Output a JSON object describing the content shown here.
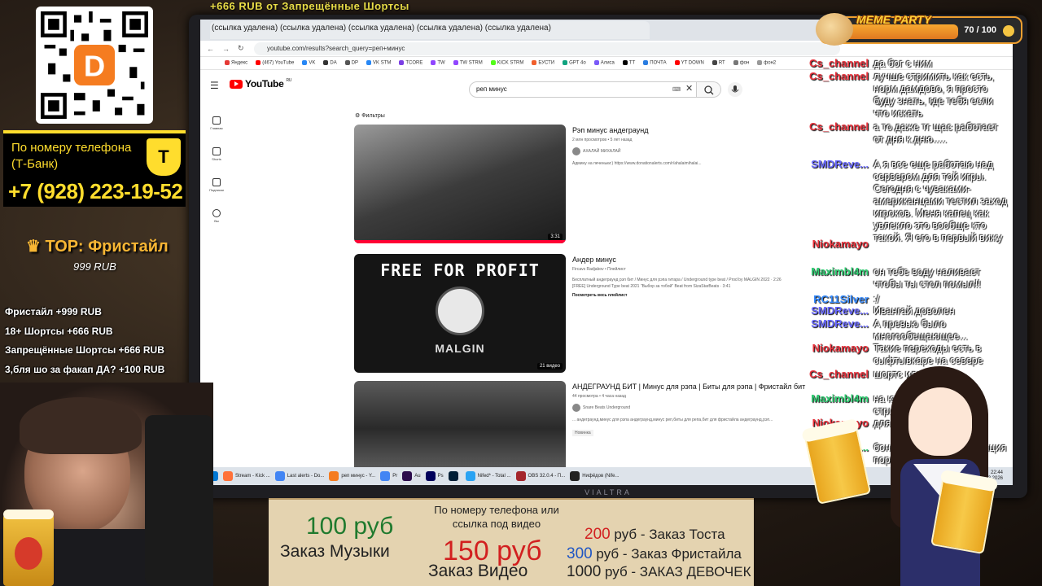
{
  "ticker": {
    "text": "+666 RUB   от Запрещённые Шортсы"
  },
  "browser": {
    "tab_title": "(ссылка удалена) (ссылка удалена) (ссылка удалена) (ссылка удалена) (ссылка удалена)",
    "url": "youtube.com/results?search_query=реп+минус",
    "bookmarks": [
      "Яндекс",
      "(467) YouTube",
      "VK",
      "DA",
      "DP",
      "VK STM",
      "TCORE",
      "TW",
      "TW STRM",
      "KICK STRM",
      "БУСТИ",
      "GPT 4o",
      "Алиса",
      "TT",
      "ПОЧТА",
      "YT DOWN",
      "RT",
      "фон",
      "фон2"
    ]
  },
  "youtube": {
    "logo_text": "YouTube",
    "region": "RU",
    "search_value": "реп минус",
    "filters_label": "Фильтры",
    "sidebar": [
      {
        "label": "Главная",
        "icon": "home-icon"
      },
      {
        "label": "Shorts",
        "icon": "shorts-icon"
      },
      {
        "label": "Подписки",
        "icon": "subscriptions-icon"
      },
      {
        "label": "Вы",
        "icon": "you-icon"
      }
    ],
    "results": [
      {
        "title": "Рэп минус андеграунд",
        "meta": "2 млн просмотров • 5 лет назад",
        "channel": "АХАЛАЙ МИХАЛАЙ",
        "desc": "Админу на печеньки:) https://www.donationalerts.com/r/ahalaimihalai...",
        "duration": "3:31"
      },
      {
        "title": "Андер минус",
        "meta": "Fircavs Radjabov • Плейлист",
        "desc": "Бесплатный андеграунд рэп бит / Минус для рэпа гитара / Underground type beat / Prod by MALGIN 2022 · 2:26",
        "desc2": "[FREE] Underground Type beat 2021 \"Выбор за тобой\" Beat from SizaStarBeats · 3:41",
        "link": "Посмотреть весь плейлист",
        "duration": "21 видео",
        "thumb_text": "FREE FOR PROFIT",
        "thumb_brand": "MALGIN"
      },
      {
        "title": "АНДЕГРАУНД БИТ | Минус для рэпа | Биты для рэпа | Фристайл бит",
        "meta": "44 просмотра • 4 часа назад",
        "channel": "Snare Beats Underground",
        "desc": "... андеграунд,минус для рэпа андеграунд,минус реп,биты для репа,бит для фристайла андеграунд,рэп...",
        "badge": "Новинка"
      }
    ]
  },
  "taskbar": {
    "apps": [
      "Stream - Kick ...",
      "Last alerts - Do...",
      "реп минус - Y...",
      "Pr",
      "Au",
      "Ps",
      "",
      "Nifed* - Total ...",
      "OBS 32.0.4 - П...",
      "Нифёдов (Nife..."
    ],
    "time": "22:44",
    "date": "19.02.2026"
  },
  "monitor_brand": "VIALTRA",
  "donation": {
    "label": "По номеру телефона (Т-Банк)",
    "phone": "+7 (928) 223-19-52",
    "bank_letter": "Т"
  },
  "top": {
    "title": "ТОР: Фристайл",
    "amount": "999 RUB"
  },
  "goals": [
    "Фристайл +999 RUB",
    "18+ Шортсы +666 RUB",
    "Запрещённые Шортсы +666 RUB",
    "3,бля шо за факап ДА? +100 RUB"
  ],
  "meme_party": {
    "title": "MEME PARTY",
    "count": "70 / 100",
    "progress": 0.7
  },
  "chat": [
    {
      "name": "Cs_channel",
      "color": "#e8323c",
      "msg": "да бог с ним"
    },
    {
      "name": "Cs_channel",
      "color": "#e8323c",
      "msg": "лучше стримить как есть, норм дамдово, я просто буду знать, где тебя если что искать"
    },
    {
      "name": "Cs_channel",
      "color": "#e8323c",
      "msg": "а то даже тг щас работает от дня к дню....."
    },
    {
      "name": "SMDReve...",
      "color": "#6a6aff",
      "msg": "А я все еще работаю над сервером для той игры. Сегодня с чуваками-американцами тестил заход игроков. Меня капец как увлекло это вообще кто такой. Я его в первый вижу"
    },
    {
      "name": "Niokamayo",
      "color": "#e8323c",
      "msg": ""
    },
    {
      "name": "Maximbl4m",
      "color": "#2ecc71",
      "msg": "он тебе воду наливает чтобы ты стол помыл!!"
    },
    {
      "name": "RC11Silver",
      "color": "#3a8dff",
      "msg": ":/"
    },
    {
      "name": "SMDReve...",
      "color": "#6a6aff",
      "msg": "Ивангай доволен"
    },
    {
      "name": "SMDReve...",
      "color": "#6a6aff",
      "msg": "А превью было многообещающее..."
    },
    {
      "name": "Niokamayo",
      "color": "#e8323c",
      "msg": "Такие переходы есть в сыфтывкаре на севере"
    },
    {
      "name": "Cs_channel",
      "color": "#e8323c",
      "msg": "шортс или шортс"
    },
    {
      "name": "Maximbl4m",
      "color": "#2ecc71",
      "msg": "на ютубе стрим нельзя стримить"
    },
    {
      "name": "Niokamayo",
      "color": "#e8323c",
      "msg": "для фона"
    },
    {
      "name": "Ma...",
      "color": "#2ecc71",
      "msg": "бонг ... или од... трансляция порно"
    }
  ],
  "board": {
    "top_text": "По номеру телефона или ссылка под видео",
    "music_price": "100 руб",
    "music_label": "Заказ Музыки",
    "video_price": "150 руб",
    "video_label": "Заказ Видео",
    "lines": [
      {
        "num": "200",
        "text": " руб - Заказ Тоста",
        "color": "#d22020"
      },
      {
        "num": "300",
        "text": " руб - Заказ Фристайла",
        "color": "#1f56c4"
      },
      {
        "num": "1000",
        "text": " руб - ЗАКАЗ ДЕВОЧЕК",
        "color": "#222"
      }
    ],
    "colors": {
      "music": "#1f7a2e",
      "video": "#d22020"
    }
  }
}
